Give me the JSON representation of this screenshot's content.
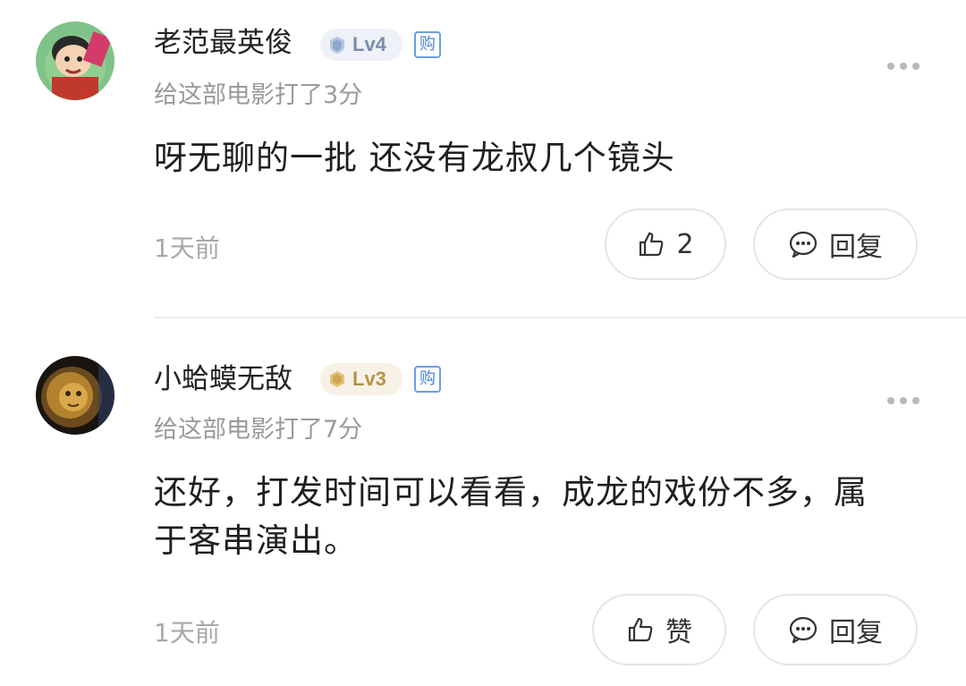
{
  "comments": [
    {
      "username": "老范最英俊",
      "level": "Lv4",
      "buy_tag": "购",
      "rating_text": "给这部电影打了3分",
      "text": "呀无聊的一批 还没有龙叔几个镜头",
      "time": "1天前",
      "like_label": "2",
      "reply_label": "回复",
      "avatar_icon": "cartoon-boy-avatar",
      "level_color": "#7a8ca8"
    },
    {
      "username": "小蛤蟆无敌",
      "level": "Lv3",
      "buy_tag": "购",
      "rating_text": "给这部电影打了7分",
      "text": "还好，打发时间可以看看，成龙的戏份不多，属于客串演出。",
      "time": "1天前",
      "like_label": "赞",
      "reply_label": "回复",
      "avatar_icon": "lion-avatar",
      "level_color": "#b4934a"
    }
  ],
  "icons": {
    "more": "more-dots-icon",
    "like": "thumbs-up-icon",
    "reply": "comment-bubble-icon"
  }
}
